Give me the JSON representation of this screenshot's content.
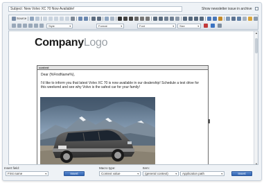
{
  "subject": {
    "value": "Subject: New Volvo XC 70 Now Available!",
    "newsletter_label": "Show newsletter issue in archive"
  },
  "toolbar": {
    "source_label": "Source",
    "style_label": "Style",
    "format_label": "Format",
    "font_label": "Font",
    "size_label": "Size"
  },
  "editor": {
    "logo_company": "Company",
    "logo_suffix": "Logo",
    "content_label": "content",
    "greeting": "Dear {%FirstName%},",
    "body": "I'd like to inform you that latest Volvo XC 70 is now available in our dealership! Schedule a test drive for this weekend and see why Volvo is the safest car for your family!"
  },
  "bottom": {
    "insert_field_label": "Insert field:",
    "insert_field_value": "First name",
    "insert_field_button": "Insert",
    "macro_type_label": "Macro type:",
    "macro_type_value": "Context value",
    "item_label": "Item:",
    "item_value": "(general context)",
    "item_value2": "Application path",
    "insert_macro_button": "Insert"
  }
}
